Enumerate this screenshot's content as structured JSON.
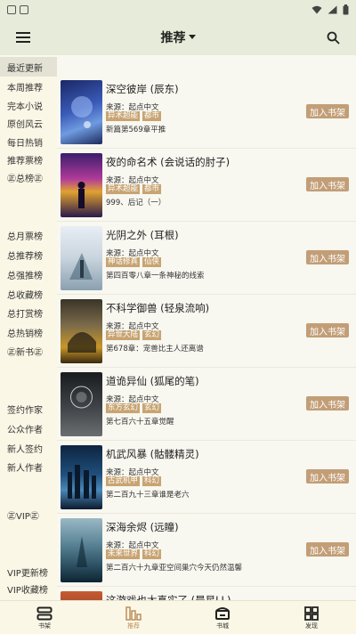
{
  "appbar": {
    "title": "推荐"
  },
  "sidebar": {
    "items": [
      {
        "label": "最近更新",
        "active": true
      },
      {
        "label": "本周推荐"
      },
      {
        "label": "完本小说"
      },
      {
        "label": "原创风云"
      },
      {
        "label": "每日热销"
      },
      {
        "label": "推荐票榜"
      },
      {
        "label": "㊣总榜㊣"
      },
      {
        "label": "总月票榜"
      },
      {
        "label": "总推荐榜"
      },
      {
        "label": "总强推榜"
      },
      {
        "label": "总收藏榜"
      },
      {
        "label": "总打赏榜"
      },
      {
        "label": "总热销榜"
      },
      {
        "label": "㊣新书㊣"
      },
      {
        "label": "签约作家"
      },
      {
        "label": "公众作者"
      },
      {
        "label": "新人签约"
      },
      {
        "label": "新人作者"
      },
      {
        "label": "㊣VIP㊣"
      },
      {
        "label": "VIP更新榜"
      },
      {
        "label": "VIP收藏榜"
      }
    ]
  },
  "books": [
    {
      "title": "深空彼岸 (辰东)",
      "source": "来源：起点中文",
      "tags": [
        "异术超能",
        "都市"
      ],
      "chapter": "新篇第569章平推",
      "add": "加入书架"
    },
    {
      "title": "夜的命名术 (会说话的肘子)",
      "source": "来源：起点中文",
      "tags": [
        "异术超能",
        "都市"
      ],
      "chapter": "999、后记（一）",
      "add": "加入书架"
    },
    {
      "title": "光阴之外 (耳根)",
      "source": "来源：起点中文",
      "tags": [
        "神话修真",
        "仙侠"
      ],
      "chapter": "第四百零八章一条神秘的线索",
      "add": "加入书架"
    },
    {
      "title": "不科学御兽 (轻泉流响)",
      "source": "来源：起点中文",
      "tags": [
        "异世大陆",
        "玄幻"
      ],
      "chapter": "第678章：宠兽比主人还离谱",
      "add": "加入书架"
    },
    {
      "title": "道诡异仙 (狐尾的笔)",
      "source": "来源：起点中文",
      "tags": [
        "东方玄幻",
        "玄幻"
      ],
      "chapter": "第七百六十五章觉醒",
      "add": "加入书架"
    },
    {
      "title": "机武风暴 (骷髅精灵)",
      "source": "来源：起点中文",
      "tags": [
        "古武机甲",
        "科幻"
      ],
      "chapter": "第二百九十三章谁是老六",
      "add": "加入书架"
    },
    {
      "title": "深海余烬 (远瞳)",
      "source": "来源：起点中文",
      "tags": [
        "未来世界",
        "科幻"
      ],
      "chapter": "第二百六十九章亚空间巢穴今天仍然温馨",
      "add": "加入书架"
    },
    {
      "title": "这游戏也太真实了 (晨星LL)",
      "source": "",
      "tags": [],
      "chapter": "",
      "add": ""
    }
  ],
  "bottomnav": [
    {
      "label": "书架",
      "icon": "bookshelf-icon"
    },
    {
      "label": "推荐",
      "icon": "recommend-icon",
      "active": true
    },
    {
      "label": "书城",
      "icon": "bookstore-icon"
    },
    {
      "label": "发现",
      "icon": "discover-icon"
    }
  ]
}
